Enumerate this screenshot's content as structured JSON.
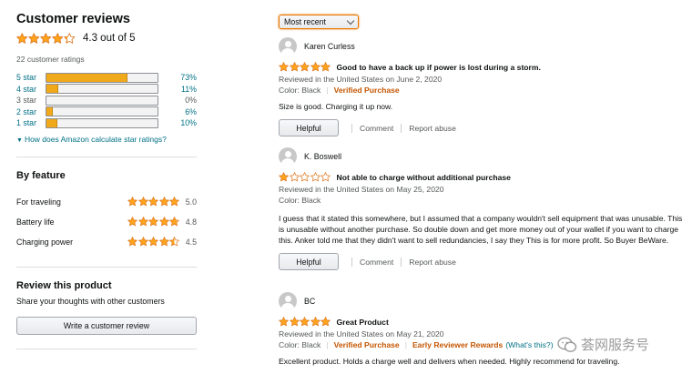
{
  "colors": {
    "star": "#ffa41c",
    "link": "#007185",
    "verified": "#c45500",
    "bar": "#f0a91b"
  },
  "summary": {
    "title": "Customer reviews",
    "rating": 4.3,
    "rating_text": "4.3 out of 5",
    "total": "22 customer ratings",
    "histogram": [
      {
        "label": "5 star",
        "percent": 73,
        "pct_text": "73%",
        "link": true
      },
      {
        "label": "4 star",
        "percent": 11,
        "pct_text": "11%",
        "link": true
      },
      {
        "label": "3 star",
        "percent": 0,
        "pct_text": "0%",
        "link": false
      },
      {
        "label": "2 star",
        "percent": 6,
        "pct_text": "6%",
        "link": true
      },
      {
        "label": "1 star",
        "percent": 10,
        "pct_text": "10%",
        "link": true
      }
    ],
    "how_link": "How does Amazon calculate star ratings?"
  },
  "by_feature": {
    "title": "By feature",
    "items": [
      {
        "name": "For traveling",
        "rating": 5.0,
        "value": "5.0"
      },
      {
        "name": "Battery life",
        "rating": 4.8,
        "value": "4.8"
      },
      {
        "name": "Charging power",
        "rating": 4.5,
        "value": "4.5"
      }
    ]
  },
  "review_product": {
    "title": "Review this product",
    "text": "Share your thoughts with other customers",
    "button": "Write a customer review"
  },
  "sort": {
    "selected": "Most recent"
  },
  "reviews": [
    {
      "name": "Karen Curless",
      "rating": 5,
      "title": "Good to have a back up if power is lost during a storm.",
      "meta": "Reviewed in the United States on June 2, 2020",
      "color": "Color: Black",
      "verified": "Verified Purchase",
      "body": "Size is good. Charging it up now.",
      "helpful": "Helpful",
      "comment": "Comment",
      "report": "Report abuse"
    },
    {
      "name": "K. Boswell",
      "rating": 1,
      "title": "Not able to charge without additional purchase",
      "meta": "Reviewed in the United States on May 25, 2020",
      "color": "Color: Black",
      "body": "I guess that it stated this somewhere, but I assumed that a company wouldn't sell equipment that was unusable. This is unusable without another purchase. So double down and get more money out of your wallet if you want to charge this. Anker told me that they didn't want to sell redundancies, I say they This is for more profit. So Buyer BeWare.",
      "helpful": "Helpful",
      "comment": "Comment",
      "report": "Report abuse"
    },
    {
      "name": "BC",
      "rating": 5,
      "title": "Great Product",
      "meta": "Reviewed in the United States on May 21, 2020",
      "color": "Color: Black",
      "verified": "Verified Purchase",
      "early": "Early Reviewer Rewards",
      "whats_this": "(What's this?)",
      "body": "Excellent product. Holds a charge well and delivers when needed. Highly recommend for traveling."
    }
  ],
  "watermark": "荟网服务号"
}
